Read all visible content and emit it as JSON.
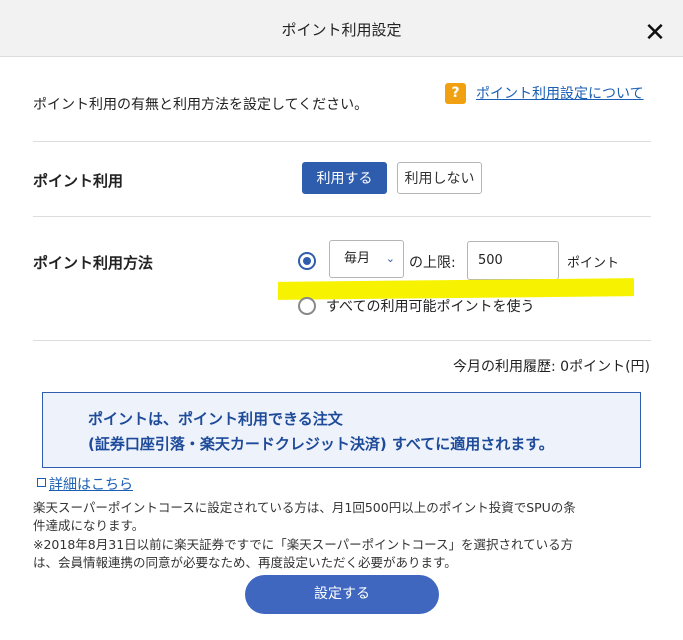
{
  "dialog": {
    "title": "ポイント利用設定",
    "close_glyph": "✕"
  },
  "intro": {
    "text": "ポイント利用の有無と利用方法を設定してください。",
    "help_icon": "?",
    "help_link": "ポイント利用設定について"
  },
  "point_use": {
    "label": "ポイント利用",
    "use_label": "利用する",
    "no_use_label": "利用しない",
    "selected": "利用する"
  },
  "method": {
    "label": "ポイント利用方法",
    "frequency_value": "毎月",
    "limit_label": "の上限:",
    "limit_value": "500",
    "unit": "ポイント",
    "all_points_label": "すべての利用可能ポイントを使う",
    "selected": "limit"
  },
  "history": {
    "text": "今月の利用履歴: 0ポイント(円)"
  },
  "notice": {
    "line1": "ポイントは、ポイント利用できる注文",
    "line2": "(証券口座引落・楽天カードクレジット決済) すべてに適用されます。"
  },
  "details": {
    "link": "詳細はこちら",
    "note1a": "楽天スーパーポイントコースに設定されている方は、月1回500円以上のポイント投資でSPUの条",
    "note1b": "件達成になります。",
    "note2a": "※2018年8月31日以前に楽天証券ですでに「楽天スーパーポイントコース」を選択されている方",
    "note2b": "は、会員情報連携の同意が必要なため、再度設定いただく必要があります。"
  },
  "submit": {
    "label": "設定する"
  },
  "colors": {
    "primary": "#2f5dae",
    "link": "#1a5fb4",
    "help_badge": "#f0a010",
    "highlight": "#f7f200"
  },
  "icons": {
    "close": "close-icon",
    "help": "help-icon",
    "chevron": "chevron-down-icon"
  }
}
